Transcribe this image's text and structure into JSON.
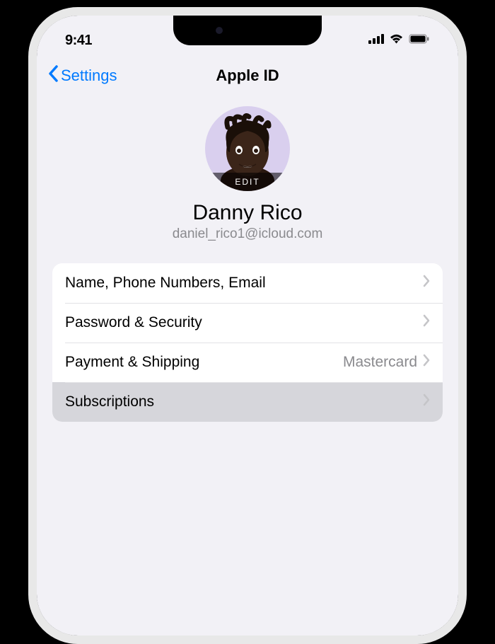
{
  "status": {
    "time": "9:41"
  },
  "nav": {
    "back_label": "Settings",
    "title": "Apple ID"
  },
  "profile": {
    "edit_label": "EDIT",
    "name": "Danny Rico",
    "email": "daniel_rico1@icloud.com"
  },
  "rows": {
    "name_phone_email": {
      "label": "Name, Phone Numbers, Email"
    },
    "password_security": {
      "label": "Password & Security"
    },
    "payment_shipping": {
      "label": "Payment & Shipping",
      "value": "Mastercard"
    },
    "subscriptions": {
      "label": "Subscriptions"
    }
  }
}
